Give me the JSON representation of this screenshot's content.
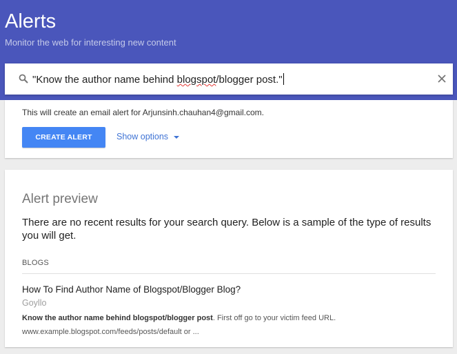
{
  "header": {
    "title": "Alerts",
    "subtitle": "Monitor the web for interesting new content",
    "background": "#4a56bb"
  },
  "search": {
    "query_before": "\"Know the author name behind ",
    "query_misspelled": "blogspot",
    "query_after": "/blogger post.\"",
    "search_icon": "search-icon",
    "clear_icon": "close-icon"
  },
  "create_card": {
    "email_note": "This will create an email alert for Arjunsinh.chauhan4@gmail.com.",
    "create_button_label": "CREATE ALERT",
    "show_options_label": "Show options",
    "accent": "#4486f4"
  },
  "preview": {
    "title": "Alert preview",
    "message": "There are no recent results for your search query. Below is a sample of the type of results you will get.",
    "section_label": "BLOGS",
    "result": {
      "title": "How To Find Author Name of Blogspot/Blogger Blog?",
      "source": "Goyllo",
      "snippet_bold": "Know the author name behind blogspot/blogger post",
      "snippet_rest": ". First off go to your victim feed URL.",
      "url_line": "www.example.blogspot.com/feeds/posts/default or ..."
    }
  }
}
